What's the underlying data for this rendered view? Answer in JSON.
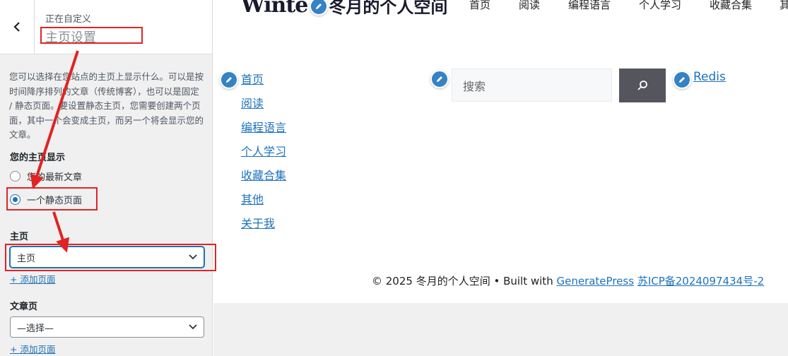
{
  "customizer": {
    "header": {
      "subtitle": "正在自定义",
      "title": "主页设置"
    },
    "description": "您可以选择在您站点的主页上显示什么。可以是按时间降序排列的文章（传统博客），也可以是固定 / 静态页面。要设置静态主页，您需要创建两个页面，其中一个会变成主页，而另一个将会显示您的文章。",
    "homepage_display": {
      "label": "您的主页显示",
      "options": [
        {
          "label": "您的最新文章",
          "selected": false
        },
        {
          "label": "一个静态页面",
          "selected": true
        }
      ]
    },
    "homepage": {
      "label": "主页",
      "selected": "主页",
      "add_link": "+ 添加页面"
    },
    "posts_page": {
      "label": "文章页",
      "selected": "—选择—",
      "add_link": "+ 添加页面"
    }
  },
  "site": {
    "logo_text": "Winte",
    "site_name": "冬月的个人空间",
    "top_nav": [
      "首页",
      "阅读",
      "编程语言",
      "个人学习",
      "收藏合集",
      "其"
    ],
    "menu": [
      "首页",
      "阅读",
      "编程语言",
      "个人学习",
      "收藏合集",
      "其他",
      "关于我"
    ],
    "search": {
      "placeholder": "搜索"
    },
    "widget_link": "Redis",
    "footer": {
      "copyright": "© 2025 冬月的个人空间 • Built with",
      "theme_link": "GeneratePress",
      "icp_link": "苏ICP备2024097434号-2"
    }
  },
  "colors": {
    "annotation": "#e02424",
    "link": "#1e73be",
    "accent": "#2271b1",
    "edit_shortcut": "#3582c4"
  },
  "icons": [
    "chevron-left-icon",
    "chevron-down-icon",
    "pencil-icon",
    "search-icon"
  ]
}
